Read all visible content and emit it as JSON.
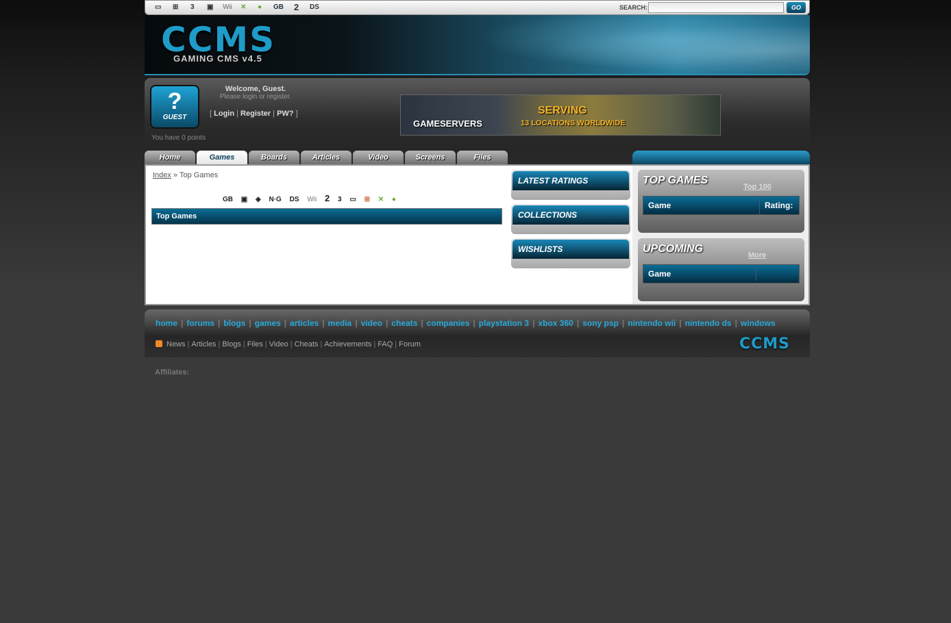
{
  "platforms_top": [
    "▭",
    "⊞",
    "3",
    "▣",
    "Wii",
    "✕",
    "●",
    "GB",
    "2",
    "DS"
  ],
  "search": {
    "label": "SEARCH:",
    "go": "GO"
  },
  "header": {
    "logo": "CCMS",
    "subtitle": "GAMING CMS v4.5"
  },
  "user": {
    "avatar_mark": "?",
    "avatar_label": "GUEST",
    "welcome": "Welcome, Guest.",
    "prompt": "Please login or register.",
    "login": "Login",
    "register": "Register",
    "pw": "PW?",
    "points": "You have 0 points"
  },
  "ad": {
    "brand": "GAMESERVERS",
    "headline": "SERVING",
    "sub": "13 LOCATIONS WORLDWIDE"
  },
  "tabs": [
    "Home",
    "Games",
    "Boards",
    "Articles",
    "Video",
    "Screens",
    "Files"
  ],
  "active_tab": "Games",
  "breadcrumb": {
    "index": "Index",
    "sep": "»",
    "current": "Top Games"
  },
  "platforms_row": [
    "GB",
    "▣",
    "◈",
    "N·G",
    "DS",
    "Wii",
    "2",
    "3",
    "▭",
    "⊞",
    "✕",
    "●"
  ],
  "main": {
    "section_title": "Top Games"
  },
  "side_boxes": [
    "LATEST RATINGS",
    "COLLECTIONS",
    "WISHLISTS"
  ],
  "top_games": {
    "title": "TOP GAMES",
    "link": "Top 100",
    "col_game": "Game",
    "col_rating": "Rating:"
  },
  "upcoming": {
    "title": "UPCOMING",
    "link": "More",
    "col_game": "Game"
  },
  "footer_nav": [
    "home",
    "forums",
    "blogs",
    "games",
    "articles",
    "media",
    "video",
    "cheats",
    "companies",
    "playstation 3",
    "xbox 360",
    "sony psp",
    "nintendo wii",
    "nintendo ds",
    "windows"
  ],
  "footer_links": [
    "News",
    "Articles",
    "Blogs",
    "Files",
    "Video",
    "Cheats",
    "Achievements",
    "FAQ",
    "Forum"
  ],
  "footer_logo": "CCMS",
  "affiliates": "Affiliates:",
  "colors": {
    "accent": "#1e9cc8",
    "nav_link": "#29a9d8",
    "bar_dark": "#053349"
  }
}
